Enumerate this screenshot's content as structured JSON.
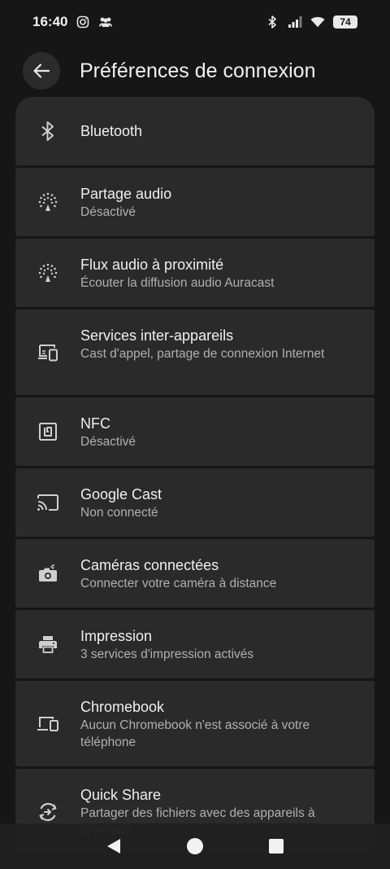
{
  "status": {
    "time": "16:40",
    "battery": "74",
    "icons": [
      "instagram-icon",
      "people-icon",
      "bluetooth-icon",
      "signal-icon",
      "wifi-icon",
      "battery-icon"
    ]
  },
  "header": {
    "title": "Préférences de connexion"
  },
  "items": [
    {
      "title": "Bluetooth",
      "subtitle": "",
      "icon": "bluetooth-icon"
    },
    {
      "title": "Partage audio",
      "subtitle": "Désactivé",
      "icon": "audio-share-icon"
    },
    {
      "title": "Flux audio à proximité",
      "subtitle": "Écouter la diffusion audio Auracast",
      "icon": "nearby-audio-icon"
    },
    {
      "title": "Services inter-appareils",
      "subtitle": "Cast d'appel, partage de connexion Internet",
      "icon": "cross-device-icon"
    },
    {
      "title": "NFC",
      "subtitle": "Désactivé",
      "icon": "nfc-icon"
    },
    {
      "title": "Google Cast",
      "subtitle": "Non connecté",
      "icon": "cast-icon"
    },
    {
      "title": "Caméras connectées",
      "subtitle": "Connecter votre caméra à distance",
      "icon": "camera-icon"
    },
    {
      "title": "Impression",
      "subtitle": "3 services d'impression activés",
      "icon": "printer-icon"
    },
    {
      "title": "Chromebook",
      "subtitle": "Aucun Chromebook n'est associé à votre téléphone",
      "icon": "chromebook-icon"
    },
    {
      "title": "Quick Share",
      "subtitle": "Partager des fichiers avec des appareils à proximité",
      "icon": "quick-share-icon"
    }
  ],
  "nav": {
    "icons": [
      "back-triangle-icon",
      "home-circle-icon",
      "recents-square-icon"
    ]
  }
}
